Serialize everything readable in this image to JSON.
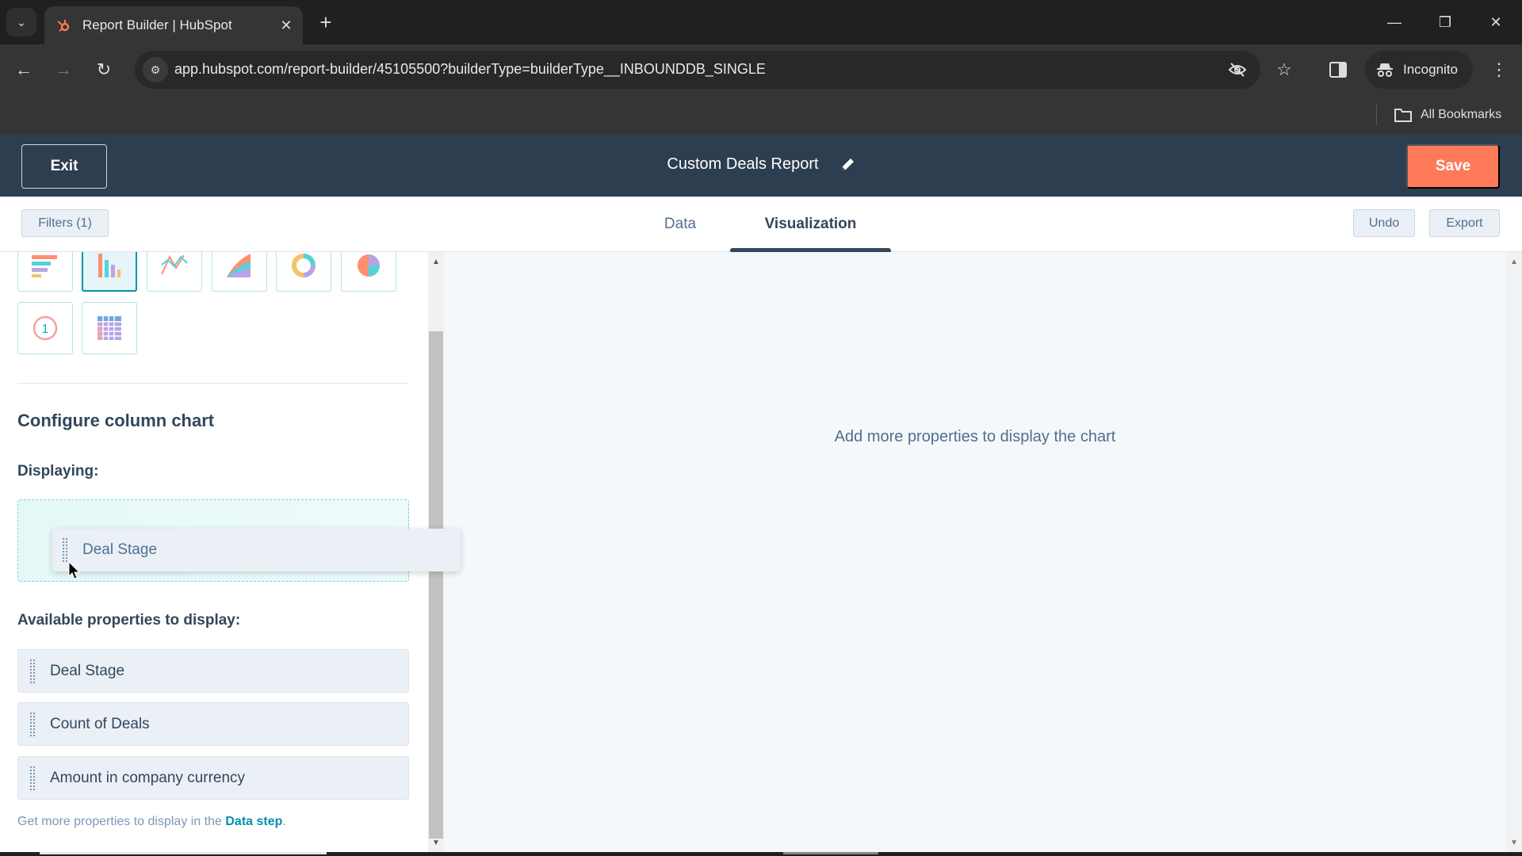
{
  "browser": {
    "tab_title": "Report Builder | HubSpot",
    "url": "app.hubspot.com/report-builder/45105500?builderType=builderType__INBOUNDDB_SINGLE",
    "incognito_label": "Incognito",
    "bookmarks_label": "All Bookmarks",
    "new_tab_symbol": "+",
    "close_tab_symbol": "✕"
  },
  "header": {
    "exit_label": "Exit",
    "report_title": "Custom Deals Report",
    "save_label": "Save",
    "save_color": "#ff7a59",
    "bg_color": "#2d3e50"
  },
  "toolbar": {
    "filters_label": "Filters (1)",
    "tabs": [
      {
        "label": "Data",
        "active": false
      },
      {
        "label": "Visualization",
        "active": true
      }
    ],
    "undo_label": "Undo",
    "export_label": "Export"
  },
  "chart_types": [
    {
      "name": "horizontal-bar",
      "selected": false
    },
    {
      "name": "column",
      "selected": true
    },
    {
      "name": "line",
      "selected": false
    },
    {
      "name": "area",
      "selected": false
    },
    {
      "name": "donut",
      "selected": false
    },
    {
      "name": "pie",
      "selected": false
    },
    {
      "name": "summary",
      "selected": false
    },
    {
      "name": "table",
      "selected": false
    }
  ],
  "config": {
    "title": "Configure column chart",
    "displaying_label": "Displaying:",
    "dragging_item": "Deal Stage",
    "available_label": "Available properties to display:",
    "available_properties": [
      "Deal Stage",
      "Count of Deals",
      "Amount in company currency"
    ],
    "footer_text": "Get more properties to display in the ",
    "footer_link": "Data step",
    "footer_end": "."
  },
  "chart_area": {
    "message": "Add more properties to display the chart"
  }
}
